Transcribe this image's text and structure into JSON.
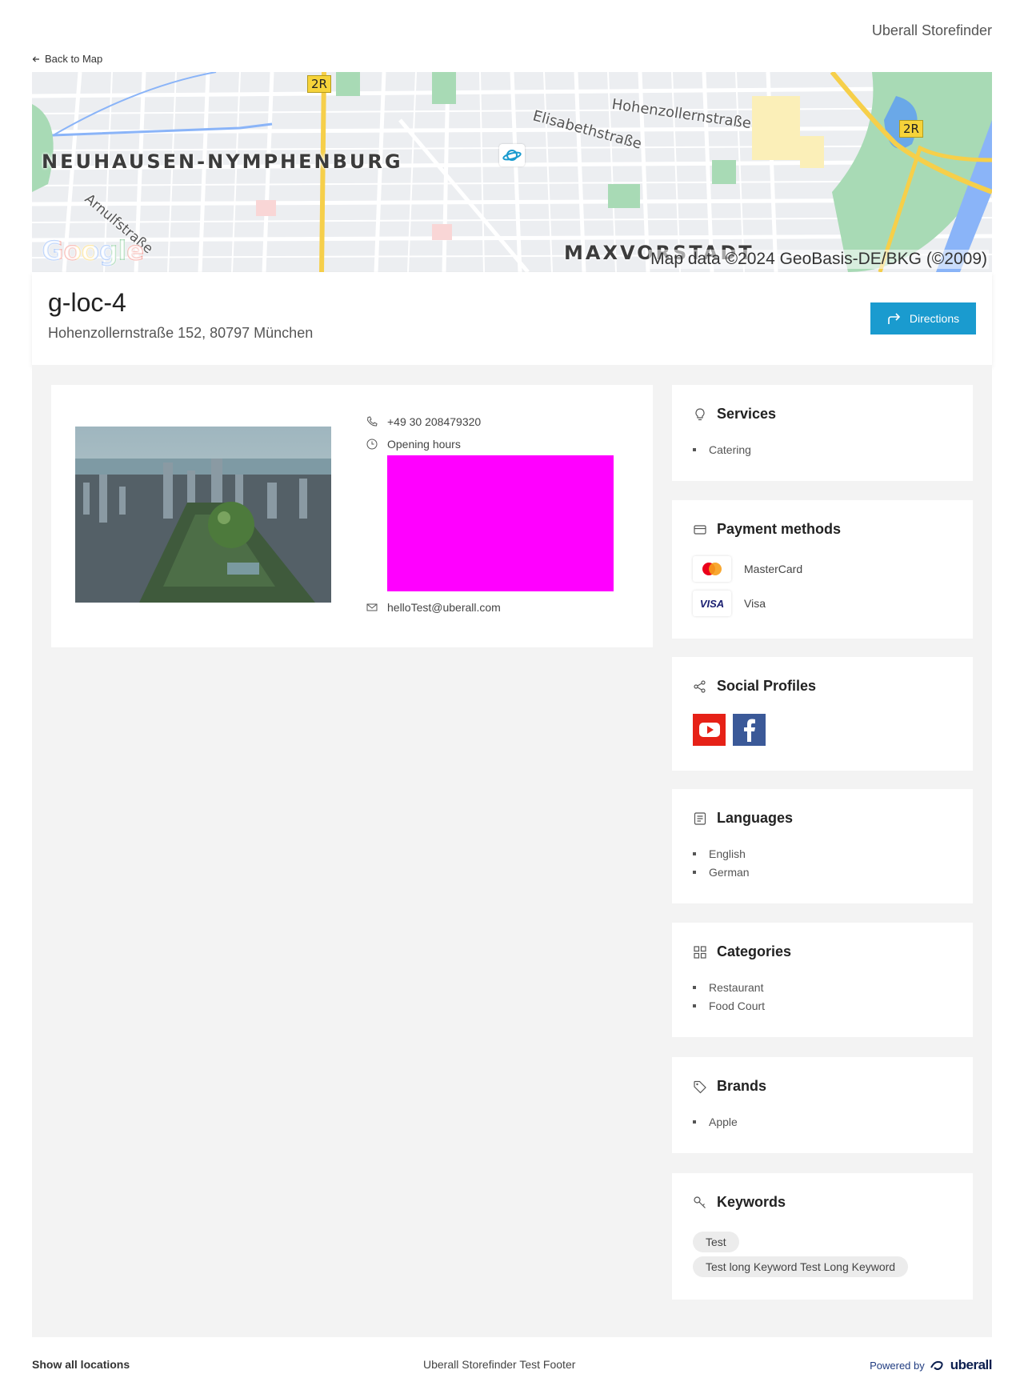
{
  "header": {
    "brand_title": "Uberall Storefinder",
    "back_label": "Back to Map"
  },
  "map": {
    "district_1": "NEUHAUSEN-NYMPHENBURG",
    "district_2": "MAXVORSTADT",
    "street_1": "Hohenzollernstraße",
    "street_2": "Elisabethstraße",
    "street_3": "Arnulfstraße",
    "road_badge": "2R",
    "google_logo": "Google",
    "attribution": "Map data ©2024 GeoBasis-DE/BKG (©2009)"
  },
  "location": {
    "name": "g-loc-4",
    "address": "Hohenzollernstraße 152, 80797 München",
    "directions_label": "Directions"
  },
  "contact": {
    "phone": "+49 30 208479320",
    "hours_label": "Opening hours",
    "email": "helloTest@uberall.com"
  },
  "services": {
    "title": "Services",
    "items": [
      "Catering"
    ]
  },
  "payment": {
    "title": "Payment methods",
    "items": [
      "MasterCard",
      "Visa"
    ]
  },
  "social": {
    "title": "Social Profiles",
    "profiles": [
      "youtube-icon",
      "facebook-icon"
    ]
  },
  "languages": {
    "title": "Languages",
    "items": [
      "English",
      "German"
    ]
  },
  "categories": {
    "title": "Categories",
    "items": [
      "Restaurant",
      "Food Court"
    ]
  },
  "brands": {
    "title": "Brands",
    "items": [
      "Apple"
    ]
  },
  "keywords": {
    "title": "Keywords",
    "items": [
      "Test",
      "Test long Keyword Test Long Keyword"
    ]
  },
  "footer": {
    "show_all": "Show all locations",
    "text": "Uberall Storefinder Test Footer",
    "powered_by": "Powered by",
    "brand": "uberall"
  },
  "colors": {
    "accent": "#1a9bcf",
    "hours_placeholder": "#ff00ff",
    "background": "#f3f3f3"
  }
}
